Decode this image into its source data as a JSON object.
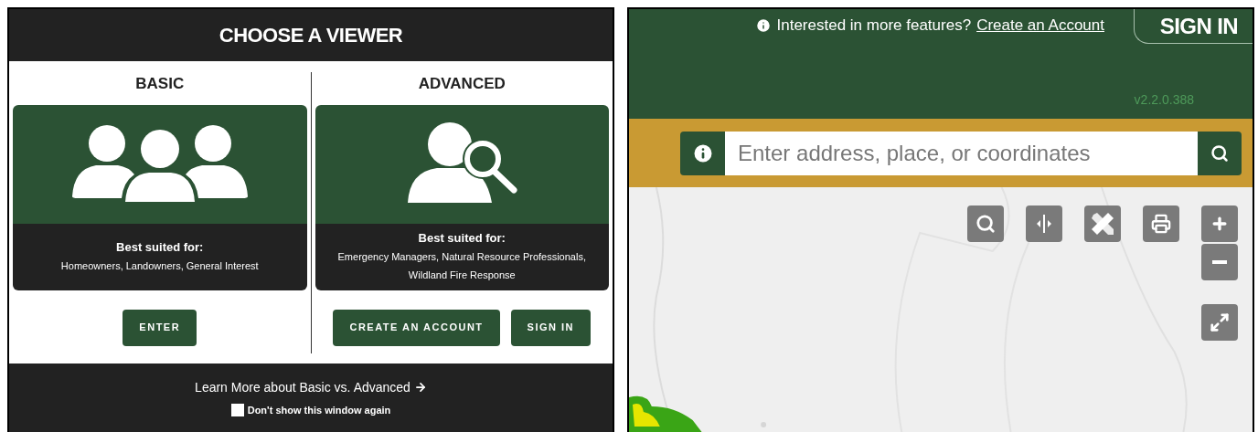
{
  "dialog": {
    "title": "CHOOSE A VIEWER",
    "columns": [
      {
        "kind": "basic",
        "heading": "BASIC",
        "suited_label": "Best suited for:",
        "suited_text": "Homeowners, Landowners, General Interest",
        "buttons": [
          "ENTER"
        ]
      },
      {
        "kind": "advanced",
        "heading": "ADVANCED",
        "suited_label": "Best suited for:",
        "suited_text": "Emergency Managers, Natural Resource Professionals, Wildland Fire Response",
        "buttons": [
          "CREATE AN ACCOUNT",
          "SIGN IN"
        ]
      }
    ],
    "learn_more": "Learn More about Basic vs. Advanced",
    "dont_show": {
      "label": "Don't show this window again",
      "checked": false
    }
  },
  "app": {
    "notice": "Interested in more features?",
    "notice_link": "Create an Account",
    "sign_in": "SIGN IN",
    "version": "v2.2.0.388",
    "search": {
      "placeholder": "Enter address, place, or coordinates"
    }
  }
}
